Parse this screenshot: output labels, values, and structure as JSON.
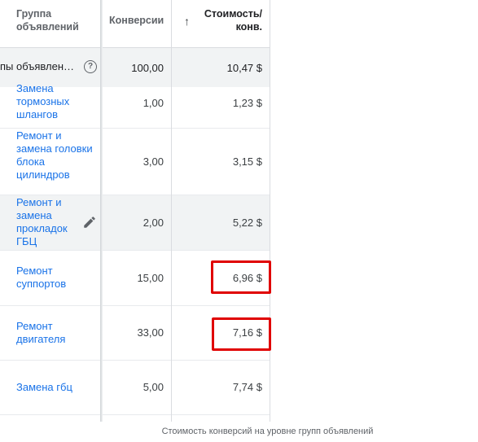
{
  "header": {
    "group_col": "Группа объявлений",
    "conv_col": "Конверсии",
    "sort_arrow": "↑",
    "cost_col": "Стоимость/ конв."
  },
  "total": {
    "name": "пы объявлен…",
    "help_icon": "?",
    "conversions": "100,00",
    "cost": "10,47 $"
  },
  "rows": [
    {
      "name": "Замена тормозных шлангов",
      "conversions": "1,00",
      "cost": "1,23 $"
    },
    {
      "name": "Ремонт и замена головки блока цилиндров",
      "conversions": "3,00",
      "cost": "3,15 $"
    },
    {
      "name": "Ремонт и замена прокладок ГБЦ",
      "conversions": "2,00",
      "cost": "5,22 $"
    },
    {
      "name": "Ремонт суппортов",
      "conversions": "15,00",
      "cost": "6,96 $"
    },
    {
      "name": "Ремонт двигателя",
      "conversions": "33,00",
      "cost": "7,16 $"
    },
    {
      "name": "Замена гбц",
      "conversions": "5,00",
      "cost": "7,74 $"
    }
  ],
  "caption": "Стоимость конверсий на уровне групп объявлений",
  "colors": {
    "link": "#1a73e8",
    "highlight_box": "#e00000"
  }
}
